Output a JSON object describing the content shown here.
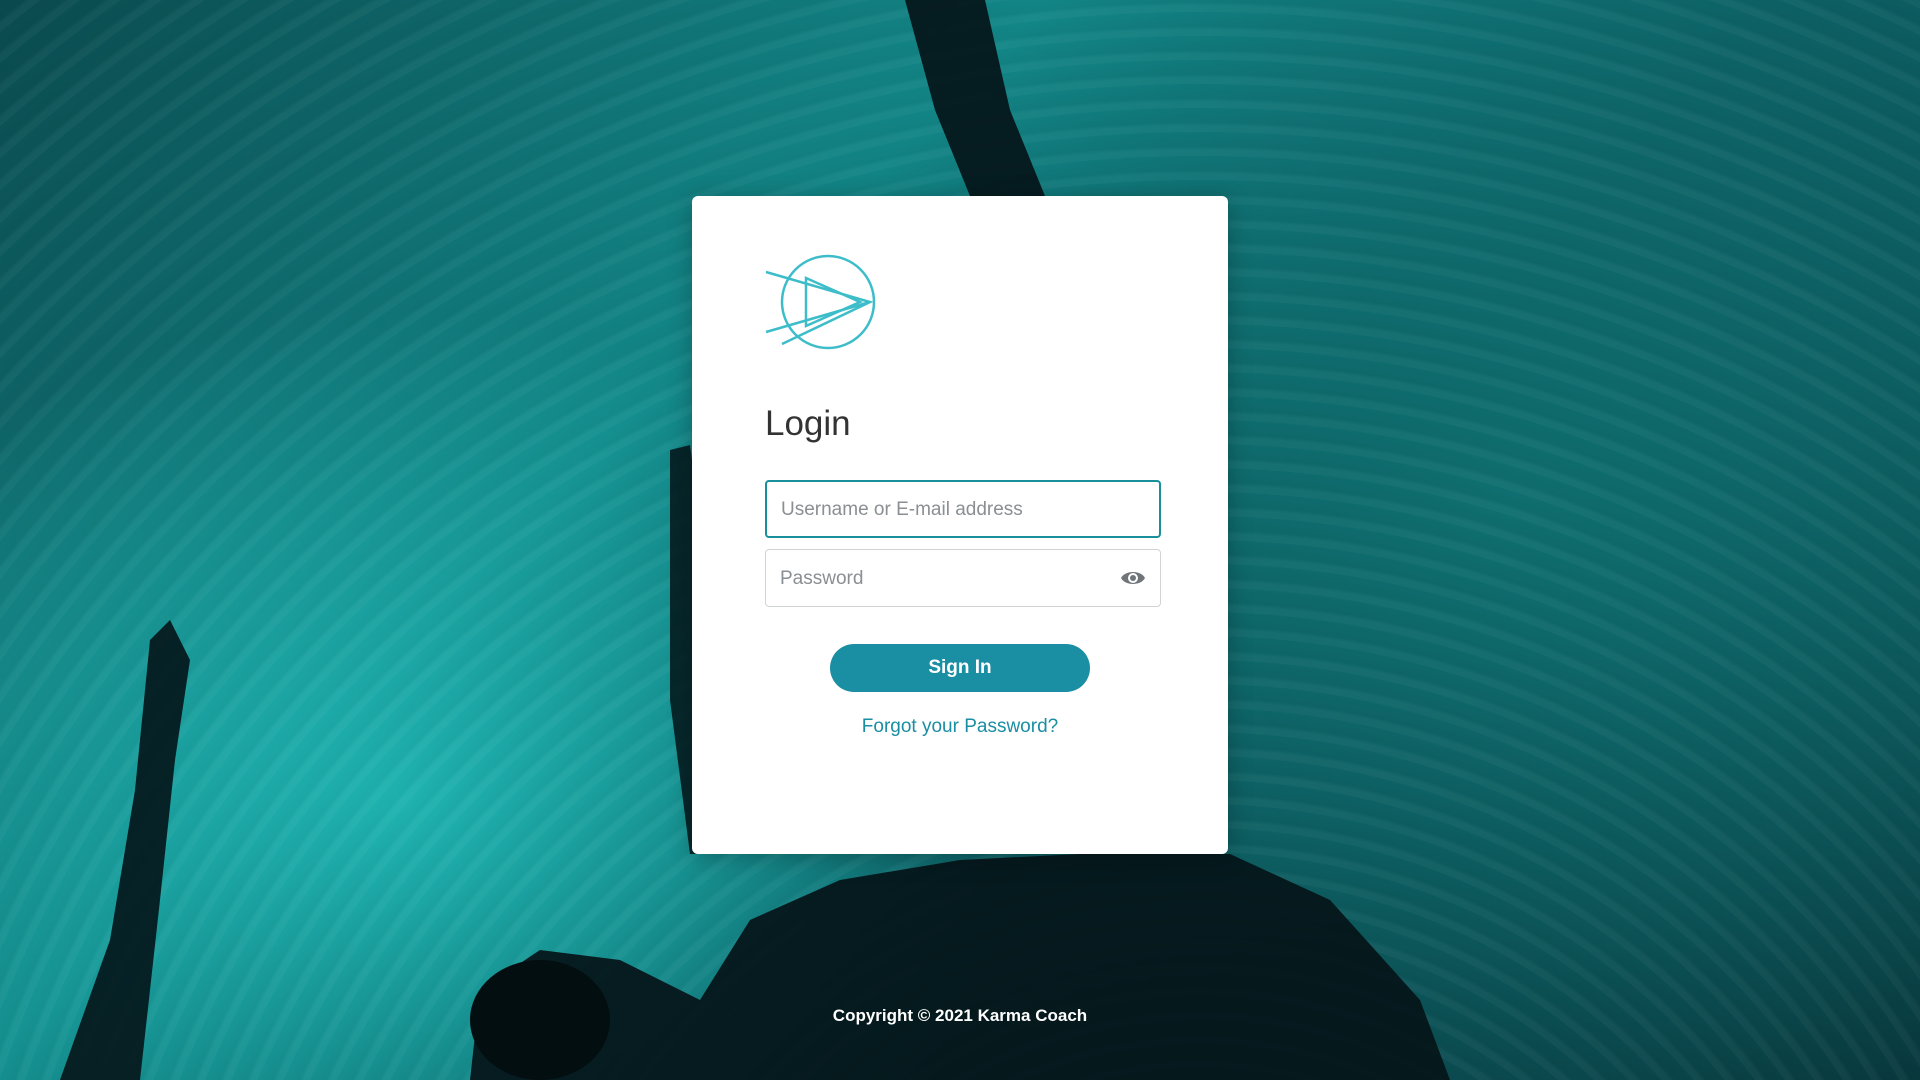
{
  "login": {
    "title": "Login",
    "username_placeholder": "Username or E-mail address",
    "password_placeholder": "Password",
    "signin_label": "Sign In",
    "forgot_label": "Forgot your Password?"
  },
  "footer": {
    "copyright": "Copyright © 2021 Karma Coach"
  },
  "icons": {
    "logo": "play-arrow-circle-logo",
    "password_toggle": "eye-icon"
  },
  "colors": {
    "accent": "#1a8ea3",
    "logo": "#3dbdc9",
    "background_teal": "#13898a"
  }
}
